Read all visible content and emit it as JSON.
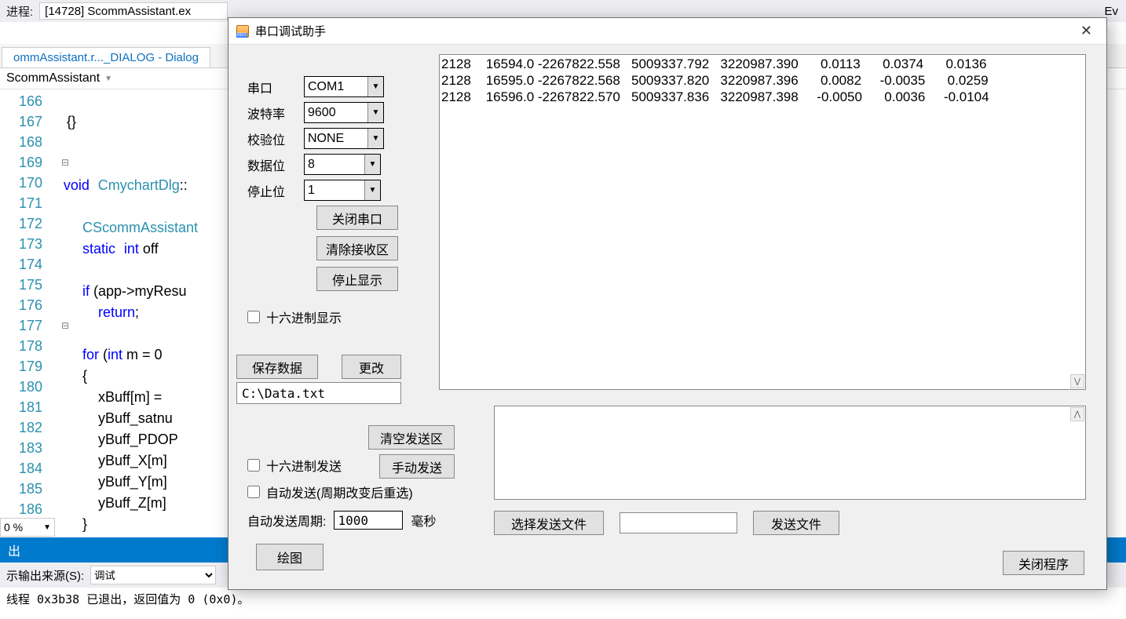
{
  "toolbar": {
    "process_label": "进程:",
    "process_value": "[14728] ScommAssistant.ex",
    "right_label": "Ev"
  },
  "tabs": {
    "tab1": "ommAssistant.r..._DIALOG - Dialog"
  },
  "breadcrumb": {
    "text": "ScommAssistant"
  },
  "code": {
    "lines": [
      "166",
      "167",
      "168",
      "169",
      "170",
      "171",
      "172",
      "173",
      "174",
      "175",
      "176",
      "177",
      "178",
      "179",
      "180",
      "181",
      "182",
      "183",
      "184",
      "185",
      "186"
    ],
    "l166": "{}",
    "l169_kw": "void",
    "l169_ty": "CmychartDlg",
    "l169_rest": "::",
    "l171_ty": "CScommAssistant",
    "l172a": "static",
    "l172b": "int",
    "l172c": " off",
    "l174a": "if",
    "l174b": " (app->myResu",
    "l175a": "return",
    "l175b": ";",
    "l177a": "for",
    "l177b": " (",
    "l177c": "int",
    "l177d": " m = 0",
    "l178": "{",
    "l179": "xBuff[m] =",
    "l180": "yBuff_satnu",
    "l181": "yBuff_PDOP",
    "l182": "yBuff_X[m]",
    "l183": "yBuff_Y[m]",
    "l184": "yBuff_Z[m]",
    "l185": "}"
  },
  "zoom": "0 %",
  "output": {
    "header": "出",
    "source_label": "示输出来源(S):",
    "source_value": "调试",
    "text": "线程 0x3b38 已退出，返回值为 0 (0x0)。"
  },
  "dialog": {
    "title": "串口调试助手",
    "port_label": "串口",
    "port_value": "COM1",
    "baud_label": "波特率",
    "baud_value": "9600",
    "parity_label": "校验位",
    "parity_value": "NONE",
    "databits_label": "数据位",
    "databits_value": "8",
    "stopbits_label": "停止位",
    "stopbits_value": "1",
    "btn_close_port": "关闭串口",
    "btn_clear_recv": "清除接收区",
    "btn_stop_disp": "停止显示",
    "chk_hex_disp": "十六进制显示",
    "btn_save": "保存数据",
    "btn_modify": "更改",
    "path": "C:\\Data.txt",
    "btn_clear_send": "清空发送区",
    "btn_manual_send": "手动发送",
    "chk_hex_send": "十六进制发送",
    "chk_auto_send": "自动发送(周期改变后重选)",
    "period_label": "自动发送周期:",
    "period_value": "1000",
    "period_unit": "毫秒",
    "btn_choose_file": "选择发送文件",
    "btn_send_file": "发送文件",
    "btn_draw": "绘图",
    "btn_close_prog": "关闭程序",
    "recv_data": "2128    16594.0 -2267822.558   5009337.792   3220987.390      0.0113      0.0374      0.0136\n2128    16595.0 -2267822.568   5009337.820   3220987.396      0.0082     -0.0035      0.0259\n2128    16596.0 -2267822.570   5009337.836   3220987.398     -0.0050      0.0036     -0.0104"
  }
}
